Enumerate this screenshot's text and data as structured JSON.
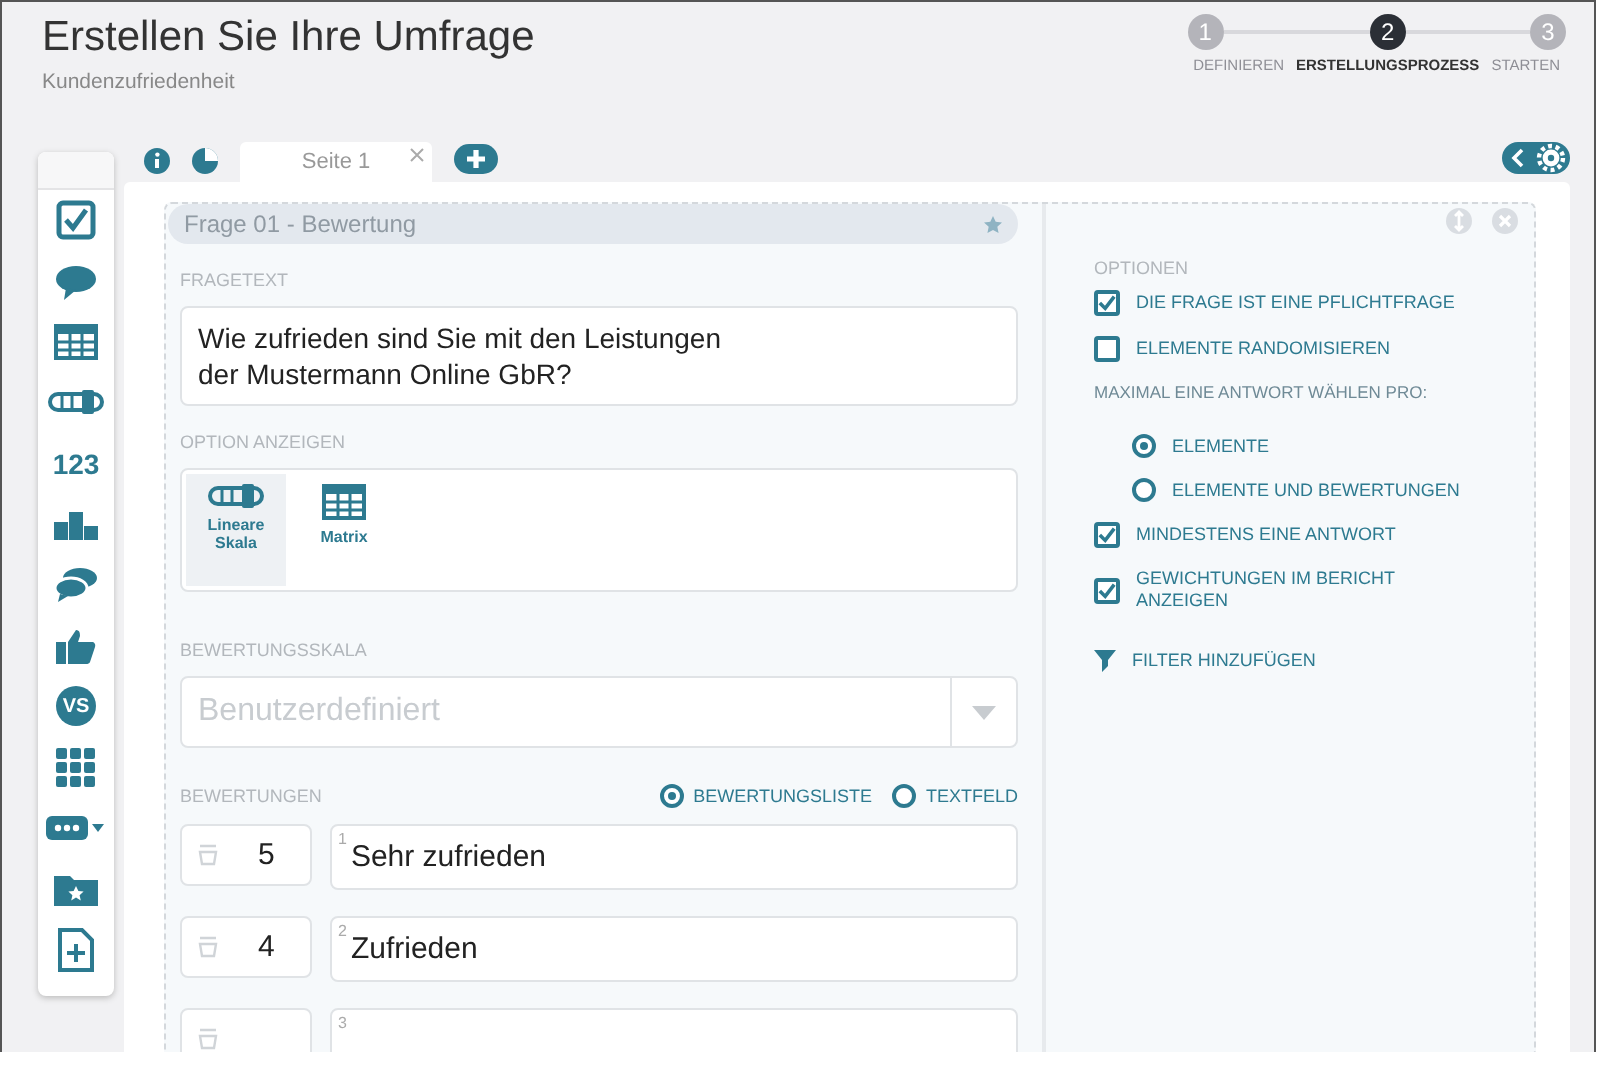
{
  "header": {
    "title": "Erstellen Sie Ihre Umfrage",
    "subtitle": "Kundenzufriedenheit"
  },
  "steps": [
    {
      "number": "1",
      "label": "DEFINIEREN",
      "selected": false
    },
    {
      "number": "2",
      "label": "ERSTELLUNGSPROZESS",
      "selected": true
    },
    {
      "number": "3",
      "label": "STARTEN",
      "selected": false
    }
  ],
  "sidebar": {
    "items": [
      {
        "kind": "checkbox"
      },
      {
        "kind": "speech"
      },
      {
        "kind": "table"
      },
      {
        "kind": "slider"
      },
      {
        "kind": "text",
        "label": "123"
      },
      {
        "kind": "podium"
      },
      {
        "kind": "chats"
      },
      {
        "kind": "thumb"
      },
      {
        "kind": "badge",
        "label": "VS"
      },
      {
        "kind": "grid"
      },
      {
        "kind": "more"
      },
      {
        "kind": "folder"
      },
      {
        "kind": "newpage"
      }
    ]
  },
  "tabs": [
    {
      "label": "Seite 1",
      "selected": true
    }
  ],
  "question": {
    "title": "Frage 01 - Bewertung",
    "fragetext_label": "FRAGETEXT",
    "fragetext_lines": [
      "Wie zufrieden sind Sie mit den Leistungen",
      "der Mustermann Online GbR?"
    ],
    "display_label": "OPTION ANZEIGEN",
    "display_options": [
      {
        "kind": "slider",
        "label": "Lineare Skala",
        "selected": true
      },
      {
        "kind": "table",
        "label": "Matrix",
        "selected": false
      }
    ],
    "scale_label": "BEWERTUNGSSKALA",
    "scale_placeholder": "Benutzerdefiniert",
    "ratings_label": "BEWERTUNGEN",
    "ratings_modes": [
      {
        "label": "BEWERTUNGSLISTE",
        "selected": true
      },
      {
        "label": "TEXTFELD",
        "selected": false
      }
    ],
    "ratings": [
      {
        "index": "1",
        "value": "5",
        "label": "Sehr zufrieden"
      },
      {
        "index": "2",
        "value": "4",
        "label": "Zufrieden"
      },
      {
        "index": "3"
      }
    ]
  },
  "options": {
    "title": "OPTIONEN",
    "items": [
      {
        "kind": "check",
        "label": "DIE FRAGE IST EINE PFLICHTFRAGE",
        "checked": true
      },
      {
        "kind": "check",
        "label": "ELEMENTE RANDOMISIEREN",
        "checked": false
      },
      {
        "kind": "note",
        "label": "MAXIMAL EINE ANTWORT WÄHLEN PRO:"
      },
      {
        "kind": "radio",
        "label": "ELEMENTE",
        "selected": true
      },
      {
        "kind": "radio",
        "label": "ELEMENTE UND BEWERTUNGEN",
        "selected": false
      },
      {
        "kind": "check",
        "label": "MINDESTENS EINE ANTWORT",
        "checked": true
      },
      {
        "kind": "check",
        "label": "GEWICHTUNGEN IM BERICHT ANZEIGEN",
        "checked": true
      },
      {
        "kind": "link",
        "label": "FILTER HINZUFÜGEN"
      }
    ]
  }
}
